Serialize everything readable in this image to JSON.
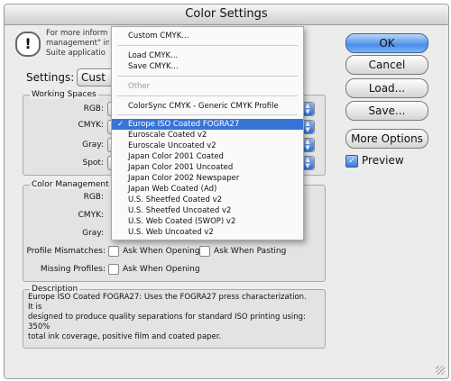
{
  "window": {
    "title": "Color Settings"
  },
  "info": {
    "line1": "For more inform",
    "line2": "management\" in",
    "line3": "Suite applicatio"
  },
  "settings": {
    "label": "Settings:",
    "value": "Cust"
  },
  "working_spaces": {
    "legend": "Working Spaces",
    "rgb_label": "RGB:",
    "cmyk_label": "CMYK:",
    "gray_label": "Gray:",
    "spot_label": "Spot:"
  },
  "color_management": {
    "legend": "Color Management",
    "rgb_label": "RGB:",
    "cmyk_label": "CMYK:",
    "gray_label": "Gray:",
    "profile_mismatches_label": "Profile Mismatches:",
    "ask_when_opening": "Ask When Opening",
    "ask_when_pasting": "Ask When Pasting",
    "missing_profiles_label": "Missing Profiles:",
    "ask_when_opening_2": "Ask When Opening"
  },
  "description": {
    "legend": "Description",
    "text_line1": "Europe ISO Coated FOGRA27:  Uses the FOGRA27 press characterization. It is",
    "text_line2": "designed to produce quality separations for standard ISO printing using: 350%",
    "text_line3": "total ink coverage, positive film and coated paper."
  },
  "buttons": {
    "ok": "OK",
    "cancel": "Cancel",
    "load": "Load...",
    "save": "Save...",
    "more_options": "More Options"
  },
  "preview": {
    "label": "Preview",
    "checked": true
  },
  "menu": {
    "custom": "Custom CMYK...",
    "load": "Load CMYK...",
    "save": "Save CMYK...",
    "other_header": "Other",
    "colorsync": "ColorSync CMYK - Generic CMYK Profile",
    "selected_check": "✓",
    "items": [
      "Europe ISO Coated FOGRA27",
      "Euroscale Coated v2",
      "Euroscale Uncoated v2",
      "Japan Color 2001 Coated",
      "Japan Color 2001 Uncoated",
      "Japan Color 2002 Newspaper",
      "Japan Web Coated (Ad)",
      "U.S. Sheetfed Coated v2",
      "U.S. Sheetfed Uncoated v2",
      "U.S. Web Coated (SWOP) v2",
      "U.S. Web Uncoated v2"
    ]
  }
}
